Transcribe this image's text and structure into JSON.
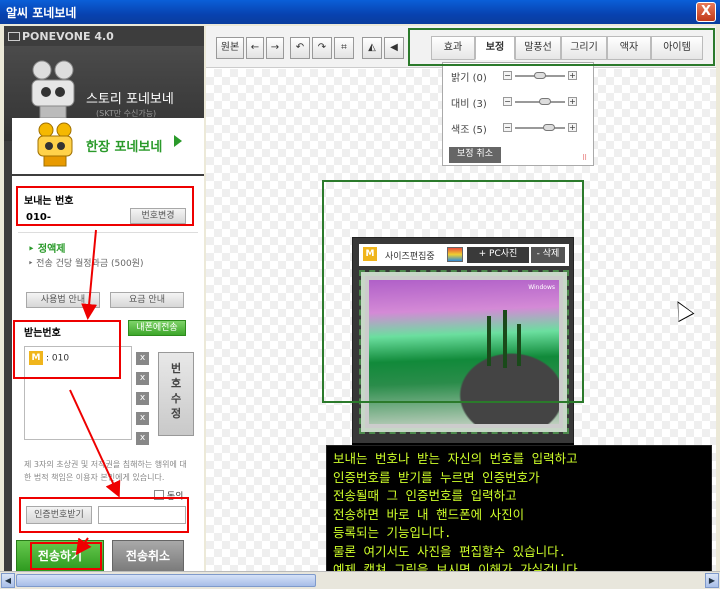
{
  "window": {
    "title": "알씨 포네보네",
    "close_label": "X"
  },
  "brand": {
    "name": "PONEVONE 4.0"
  },
  "story": {
    "title": "스토리 포네보네",
    "subtitle": "(SKT만 수신가능)"
  },
  "single": {
    "title": "한장 포네보네"
  },
  "sender": {
    "label": "보내는 번호",
    "value": "010-",
    "change_button": "번호변경"
  },
  "plan": {
    "name": "정액제",
    "desc": "전송 건당 월정과금 (500원)",
    "usage_button": "사용법 안내",
    "fee_button": "요금 안내"
  },
  "receiver": {
    "label": "받는번호",
    "my_phone_button": "내폰에전송",
    "items": [
      {
        "badge": "M",
        "number": ": 010"
      }
    ],
    "x_labels": [
      "x",
      "x",
      "x",
      "x",
      "x"
    ],
    "edit_button": "번호수정"
  },
  "notice": {
    "text": "제 3자의 초상권 및 저작권을 침해하는 행위에 대한 법적 책임은 이용자 본인에게 있습니다.",
    "agree_label": "동의"
  },
  "auth": {
    "request_button": "인증번호받기",
    "input_value": ""
  },
  "actions": {
    "send": "전송하기",
    "cancel": "전송취소"
  },
  "toolbar": {
    "original": "원본",
    "back": "←",
    "forward": "→",
    "undo": "↶",
    "redo": "↷",
    "crop": "⌗",
    "flip_h": "◭",
    "flip_v": "◀",
    "tabs": [
      "효과",
      "보정",
      "말풍선",
      "그리기",
      "액자",
      "아이템"
    ],
    "active_tab": "보정"
  },
  "adjust": {
    "rows": [
      {
        "label": "밝기 (0)",
        "value": 0
      },
      {
        "label": "대비 (3)",
        "value": 3
      },
      {
        "label": "색조 (5)",
        "value": 5
      }
    ],
    "cancel_button": "보정 취소"
  },
  "editor": {
    "badge": "M",
    "status": "사이즈편집중",
    "pc_photo_button": "+ PC사진",
    "delete_button": "- 삭제",
    "photo_logo": "Windows"
  },
  "caption": {
    "lines": [
      "보내는 번호나 받는 자신의 번호를 입력하고",
      "인증번호를 받기를 누르면 인증번호가",
      "전송될때 그 인증번호를 입력하고",
      "전송하면 바로 내 핸드폰에 사진이",
      "등록되는 기능입니다.",
      "물론 여기서도 사진을 편집할수 있습니다.",
      "예제 캡쳐 그림을 보시면 이해가 가실겁니다."
    ]
  },
  "scrollbar": {
    "left_arrow": "◀",
    "right_arrow": "▶"
  },
  "colors": {
    "accent_green": "#2a9a2a",
    "caption_text": "#cfff2a",
    "highlight_red": "#e00000",
    "highlight_green": "#2b7a2b"
  }
}
